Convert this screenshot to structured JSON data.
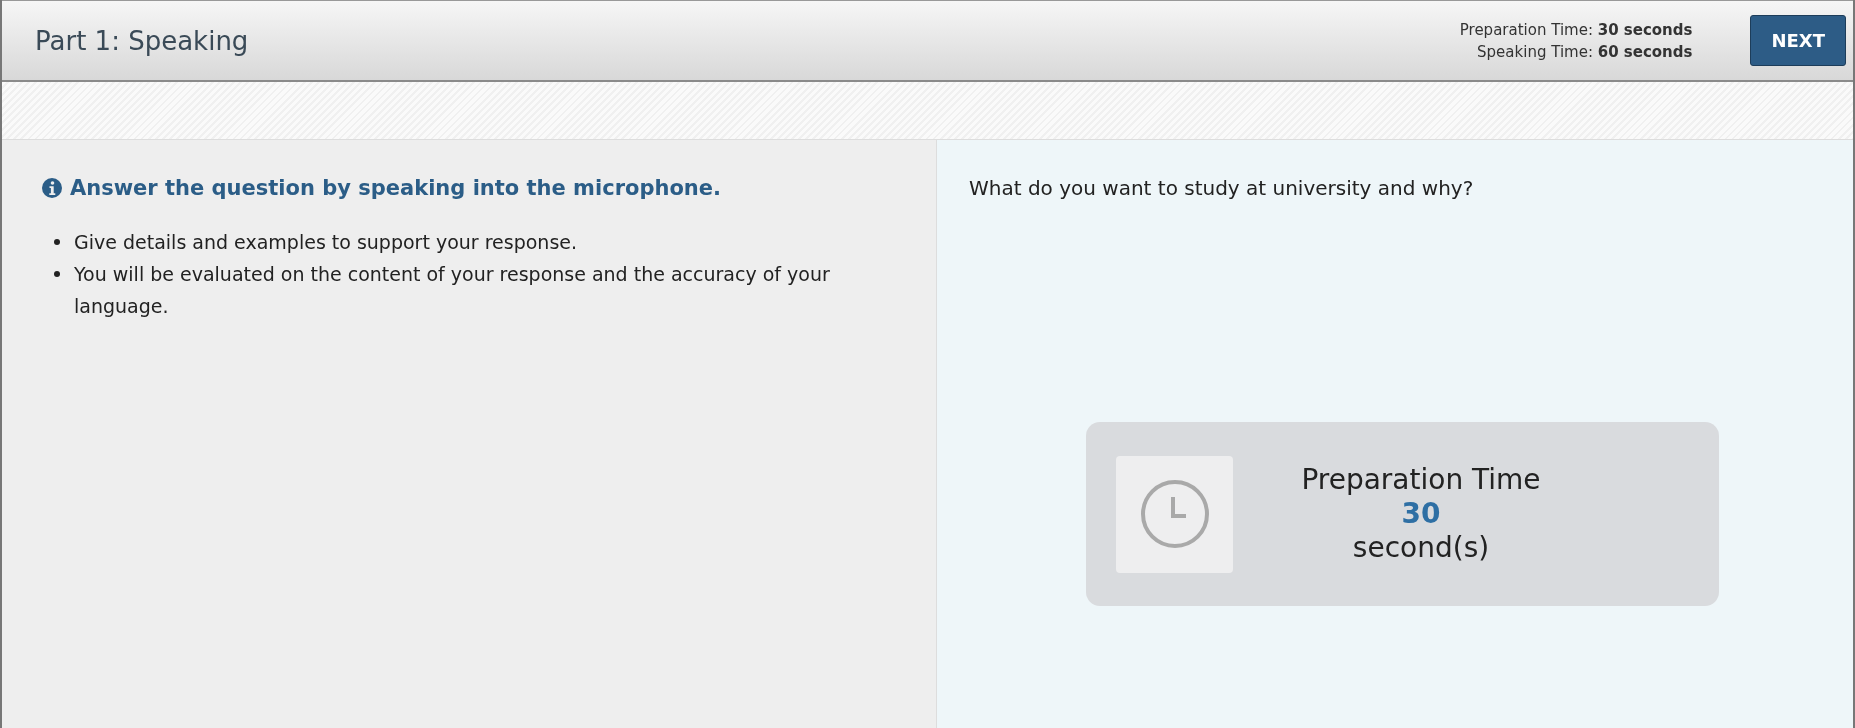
{
  "header": {
    "title": "Part 1: Speaking",
    "timings": [
      "Preparation Time: **30 seconds**",
      "Speaking Time: **60 seconds**"
    ],
    "next_button": "NEXT"
  },
  "instructions": {
    "heading": "Answer the question by speaking into the microphone.",
    "bullets": [
      "Give details and examples to support your response.",
      "You will be evaluated on the content of your response and the accuracy of your language."
    ]
  },
  "question": "What do you want to study at university and why?",
  "timer": {
    "label": "Preparation Time",
    "value": "30",
    "unit": "second(s)"
  }
}
